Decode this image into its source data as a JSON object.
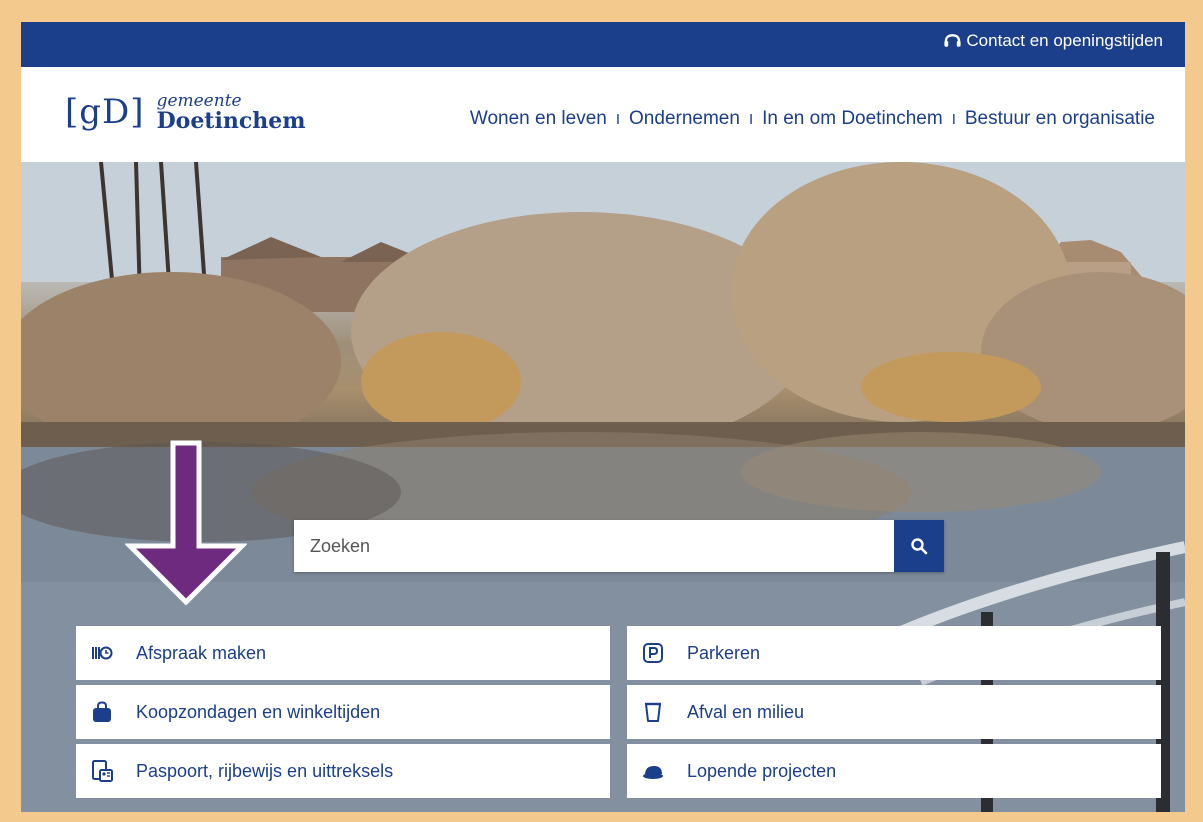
{
  "topbar": {
    "contact_label": "Contact en openingstijden",
    "contact_icon": "headset-icon"
  },
  "logo": {
    "mark": "[gD]",
    "line1": "gemeente",
    "line2": "Doetinchem"
  },
  "nav": {
    "items": [
      {
        "label": "Wonen en leven"
      },
      {
        "label": "Ondernemen"
      },
      {
        "label": "In en om Doetinchem"
      },
      {
        "label": "Bestuur en organisatie"
      }
    ],
    "separator": "I"
  },
  "search": {
    "placeholder": "Zoeken",
    "button_icon": "search-icon"
  },
  "tiles": {
    "left": [
      {
        "label": "Afspraak maken",
        "icon": "appointment-icon"
      },
      {
        "label": "Koopzondagen en winkeltijden",
        "icon": "shopping-bag-icon"
      },
      {
        "label": "Paspoort, rijbewijs en uittreksels",
        "icon": "id-document-icon"
      }
    ],
    "right": [
      {
        "label": "Parkeren",
        "icon": "parking-icon"
      },
      {
        "label": "Afval en milieu",
        "icon": "waste-bin-icon"
      },
      {
        "label": "Lopende projecten",
        "icon": "hard-hat-icon"
      }
    ]
  },
  "colors": {
    "brand": "#1b3f8b",
    "frame": "#f4c98d",
    "annotation_arrow": "#6e2a7f"
  }
}
